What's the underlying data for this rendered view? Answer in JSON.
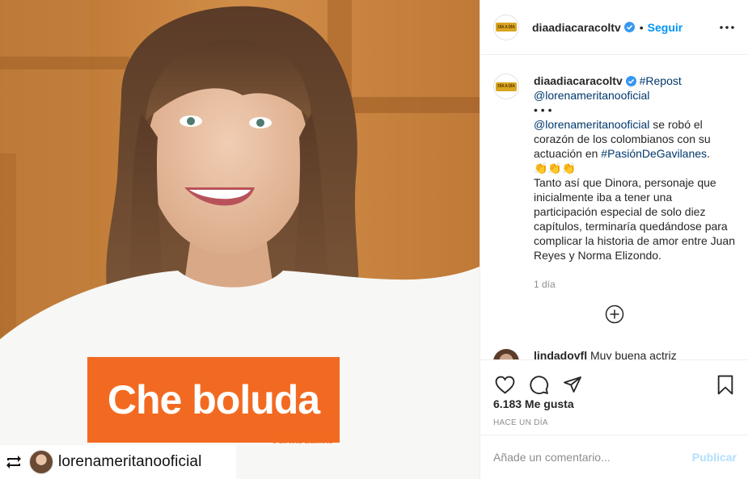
{
  "photo": {
    "shirt_text": "Che boluda",
    "shirt_signature": "Patricia Bussola",
    "repost_handle": "lorenameritanooficial"
  },
  "header": {
    "username": "diaadiacaracoltv",
    "avatar_logo_text": "DÍA A DÍA",
    "separator": "•",
    "follow_label": "Seguir"
  },
  "caption": {
    "username": "diaadiacaracoltv",
    "hashtag_repost": "#Repost",
    "mention": "@lorenameritanooficial",
    "dots": "• • •",
    "line_mention": "@lorenameritanooficial",
    "text_a": " se robó el corazón de los colombianos con su actuación en ",
    "hashtag_show": "#PasiónDeGavilanes",
    "text_b": ".",
    "emojis": "👏👏👏",
    "paragraph": "Tanto así que Dinora, personaje que inicialmente iba a tener una participación especial de solo diez capítulos, terminaría quedándose para complicar la historia de amor entre Juan Reyes y Norma Elizondo.",
    "time_ago": "1 día"
  },
  "peek_comment": {
    "username": "lindadovfl",
    "text": "Muy buena actriz"
  },
  "stats": {
    "likes": "6.183 Me gusta",
    "date": "HACE UN DÍA"
  },
  "comment_box": {
    "placeholder": "Añade un comentario...",
    "publish_label": "Publicar"
  },
  "colors": {
    "accent": "#0095f6",
    "link": "#00376b",
    "muted": "#8e8e8e",
    "publish_disabled": "#b2dffc",
    "shirt_banner": "#f26a21"
  }
}
